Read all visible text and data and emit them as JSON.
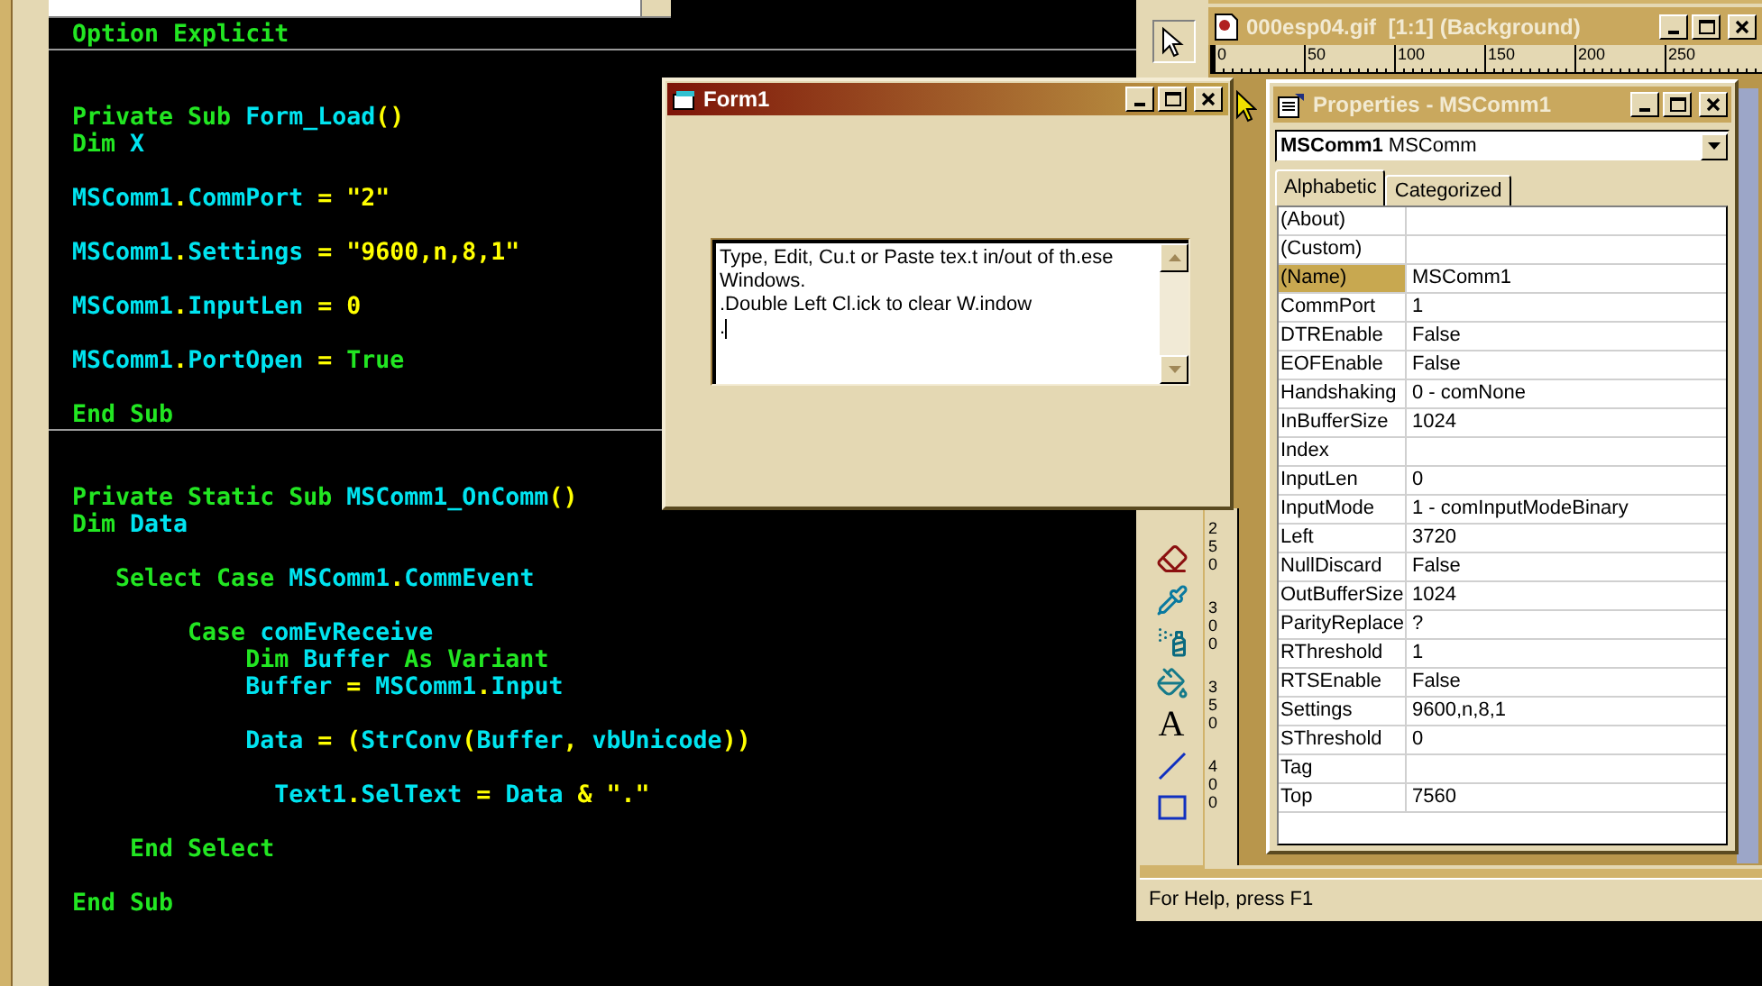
{
  "code_editor": {
    "lines": [
      {
        "kind": "code",
        "tokens": [
          {
            "kind": "keyword",
            "text": "Option Explicit"
          }
        ]
      },
      {
        "kind": "separator"
      },
      {
        "kind": "blank"
      },
      {
        "kind": "blank"
      },
      {
        "kind": "code",
        "tokens": [
          {
            "kind": "keyword",
            "text": "Private Sub "
          },
          {
            "kind": "identifier",
            "text": "Form_Load"
          },
          {
            "kind": "literal",
            "text": "()"
          }
        ]
      },
      {
        "kind": "code",
        "tokens": [
          {
            "kind": "keyword",
            "text": "Dim "
          },
          {
            "kind": "identifier",
            "text": "X"
          }
        ]
      },
      {
        "kind": "blank"
      },
      {
        "kind": "code",
        "tokens": [
          {
            "kind": "identifier",
            "text": "MSComm1"
          },
          {
            "kind": "literal",
            "text": "."
          },
          {
            "kind": "identifier",
            "text": "CommPort"
          },
          {
            "kind": "literal",
            "text": " = \"2\""
          }
        ]
      },
      {
        "kind": "blank"
      },
      {
        "kind": "code",
        "tokens": [
          {
            "kind": "identifier",
            "text": "MSComm1"
          },
          {
            "kind": "literal",
            "text": "."
          },
          {
            "kind": "identifier",
            "text": "Settings"
          },
          {
            "kind": "literal",
            "text": " = \"9600,n,8,1\""
          }
        ]
      },
      {
        "kind": "blank"
      },
      {
        "kind": "code",
        "tokens": [
          {
            "kind": "identifier",
            "text": "MSComm1"
          },
          {
            "kind": "literal",
            "text": "."
          },
          {
            "kind": "identifier",
            "text": "InputLen"
          },
          {
            "kind": "literal",
            "text": " = 0"
          }
        ]
      },
      {
        "kind": "blank"
      },
      {
        "kind": "code",
        "tokens": [
          {
            "kind": "identifier",
            "text": "MSComm1"
          },
          {
            "kind": "literal",
            "text": "."
          },
          {
            "kind": "identifier",
            "text": "PortOpen"
          },
          {
            "kind": "literal",
            "text": " = "
          },
          {
            "kind": "keyword",
            "text": "True"
          }
        ]
      },
      {
        "kind": "blank"
      },
      {
        "kind": "code",
        "tokens": [
          {
            "kind": "keyword",
            "text": "End Sub"
          }
        ]
      },
      {
        "kind": "separator"
      },
      {
        "kind": "blank"
      },
      {
        "kind": "blank"
      },
      {
        "kind": "code",
        "tokens": [
          {
            "kind": "keyword",
            "text": "Private Static Sub "
          },
          {
            "kind": "identifier",
            "text": "MSComm1_OnComm"
          },
          {
            "kind": "literal",
            "text": "()"
          }
        ]
      },
      {
        "kind": "code",
        "tokens": [
          {
            "kind": "keyword",
            "text": "Dim "
          },
          {
            "kind": "identifier",
            "text": "Data"
          }
        ]
      },
      {
        "kind": "blank"
      },
      {
        "kind": "code",
        "tokens": [
          {
            "kind": "keyword",
            "text": "   Select Case "
          },
          {
            "kind": "identifier",
            "text": "MSComm1"
          },
          {
            "kind": "literal",
            "text": "."
          },
          {
            "kind": "identifier",
            "text": "CommEvent"
          }
        ]
      },
      {
        "kind": "blank"
      },
      {
        "kind": "code",
        "tokens": [
          {
            "kind": "keyword",
            "text": "        Case "
          },
          {
            "kind": "identifier",
            "text": "comEvReceive"
          }
        ]
      },
      {
        "kind": "code",
        "tokens": [
          {
            "kind": "keyword",
            "text": "            Dim "
          },
          {
            "kind": "identifier",
            "text": "Buffer "
          },
          {
            "kind": "keyword",
            "text": "As Variant"
          }
        ]
      },
      {
        "kind": "code",
        "tokens": [
          {
            "kind": "identifier",
            "text": "            Buffer"
          },
          {
            "kind": "literal",
            "text": " = "
          },
          {
            "kind": "identifier",
            "text": "MSComm1"
          },
          {
            "kind": "literal",
            "text": "."
          },
          {
            "kind": "identifier",
            "text": "Input"
          }
        ]
      },
      {
        "kind": "blank"
      },
      {
        "kind": "code",
        "tokens": [
          {
            "kind": "identifier",
            "text": "            Data"
          },
          {
            "kind": "literal",
            "text": " = ("
          },
          {
            "kind": "identifier",
            "text": "StrConv"
          },
          {
            "kind": "literal",
            "text": "("
          },
          {
            "kind": "identifier",
            "text": "Buffer"
          },
          {
            "kind": "literal",
            "text": ", "
          },
          {
            "kind": "identifier",
            "text": "vbUnicode"
          },
          {
            "kind": "literal",
            "text": "))"
          }
        ]
      },
      {
        "kind": "blank"
      },
      {
        "kind": "code",
        "tokens": [
          {
            "kind": "identifier",
            "text": "              Text1"
          },
          {
            "kind": "literal",
            "text": "."
          },
          {
            "kind": "identifier",
            "text": "SelText"
          },
          {
            "kind": "literal",
            "text": " = "
          },
          {
            "kind": "identifier",
            "text": "Data"
          },
          {
            "kind": "literal",
            "text": " & \".\""
          }
        ]
      },
      {
        "kind": "blank"
      },
      {
        "kind": "code",
        "tokens": [
          {
            "kind": "keyword",
            "text": "    End Select"
          }
        ]
      },
      {
        "kind": "blank"
      },
      {
        "kind": "code",
        "tokens": [
          {
            "kind": "keyword",
            "text": "End Sub"
          }
        ]
      }
    ]
  },
  "form_window": {
    "title": "Form1",
    "text_box": {
      "value": "Type, Edit, Cu.t or Paste tex.t in/out of th.ese Windows.\n.Double Left Cl.ick to clear W.indow\n."
    }
  },
  "image_window": {
    "title": "000esp04.gif  [1:1] (Background)",
    "ruler_labels": [
      "0",
      "50",
      "100",
      "150",
      "200",
      "250"
    ]
  },
  "toolbox": {
    "top_tools": [
      {
        "kind": "pointer"
      }
    ],
    "tools": [
      {
        "kind": "eraser"
      },
      {
        "kind": "picker"
      },
      {
        "kind": "airbrush"
      },
      {
        "kind": "fill"
      },
      {
        "kind": "text",
        "label": "A"
      },
      {
        "kind": "line"
      },
      {
        "kind": "rectangle"
      }
    ]
  },
  "vertical_ruler": {
    "labels": [
      "250",
      "300",
      "350",
      "400"
    ]
  },
  "properties": {
    "title": "Properties - MSComm1",
    "object": {
      "name": "MSComm1",
      "type": "MSComm"
    },
    "tabs": [
      {
        "label": "Alphabetic",
        "selected": true
      },
      {
        "label": "Categorized",
        "selected": false
      }
    ],
    "rows": [
      {
        "name": "(About)",
        "selected": false
      },
      {
        "name": "(Custom)",
        "selected": false
      },
      {
        "name": "(Name)",
        "value": "MSComm1",
        "selected": true
      },
      {
        "name": "CommPort",
        "value": "1",
        "selected": false
      },
      {
        "name": "DTREnable",
        "value": "False",
        "selected": false
      },
      {
        "name": "EOFEnable",
        "value": "False",
        "selected": false
      },
      {
        "name": "Handshaking",
        "value": "0 - comNone",
        "selected": false
      },
      {
        "name": "InBufferSize",
        "value": "1024",
        "selected": false
      },
      {
        "name": "Index",
        "selected": false
      },
      {
        "name": "InputLen",
        "value": "0",
        "selected": false
      },
      {
        "name": "InputMode",
        "value": "1 - comInputModeBinary",
        "selected": false
      },
      {
        "name": "Left",
        "value": "3720",
        "selected": false
      },
      {
        "name": "NullDiscard",
        "value": "False",
        "selected": false
      },
      {
        "name": "OutBufferSize",
        "value": "1024",
        "selected": false
      },
      {
        "name": "ParityReplace",
        "value": "?",
        "selected": false
      },
      {
        "name": "RThreshold",
        "value": "1",
        "selected": false
      },
      {
        "name": "RTSEnable",
        "value": "False",
        "selected": false
      },
      {
        "name": "Settings",
        "value": "9600,n,8,1",
        "selected": false
      },
      {
        "name": "SThreshold",
        "value": "0",
        "selected": false
      },
      {
        "name": "Tag",
        "selected": false
      },
      {
        "name": "Top",
        "value": "7560",
        "selected": false
      }
    ]
  },
  "status_bar": {
    "text": "For Help, press F1"
  }
}
